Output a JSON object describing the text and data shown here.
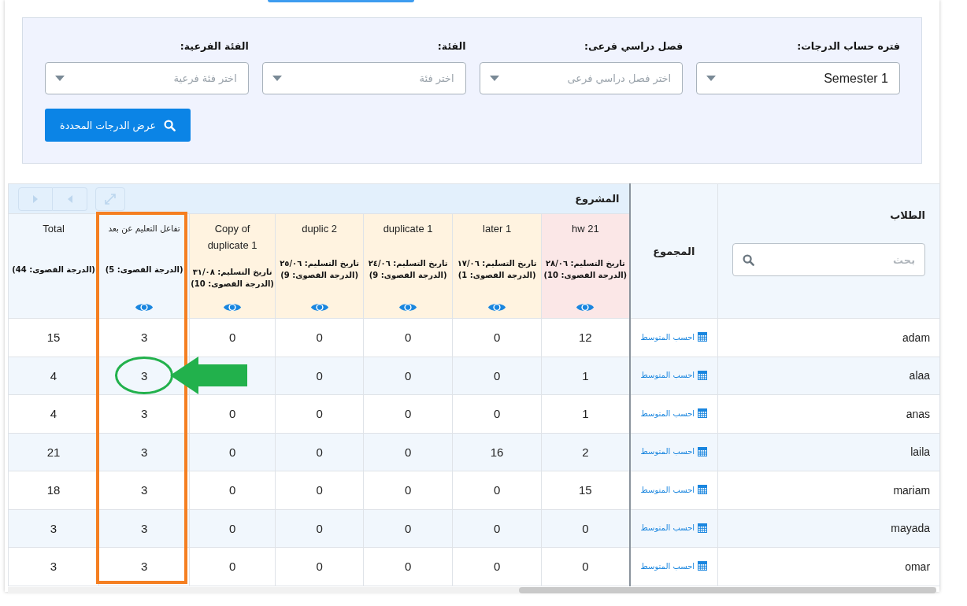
{
  "filters": [
    {
      "label": "فتره حساب الدرجات:",
      "value": "Semester 1"
    },
    {
      "label": "فصل دراسي فرعى:",
      "placeholder": "اختر فصل دراسي فرعى"
    },
    {
      "label": "الفئة:",
      "placeholder": "اختر فئة"
    },
    {
      "label": "الفئة الفرعية:",
      "placeholder": "اختر فئة فرعية"
    }
  ],
  "show_button": {
    "label": "عرض الدرجات المحددة"
  },
  "table": {
    "group_header": "المشروع",
    "columns": [
      {
        "kind": "student",
        "title": "الطلاب",
        "search_placeholder": "بحث"
      },
      {
        "kind": "sum",
        "title": "المجموع"
      },
      {
        "kind": "assignment",
        "title": "hw 21",
        "due": "تاريخ التسليم: ٢٨/٠٦",
        "max": "(الدرجة القصوى: 10)",
        "color": "#fbe7e7",
        "framed": false
      },
      {
        "kind": "assignment",
        "title": "later 1",
        "due": "تاريخ التسليم: ١٧/٠٦",
        "max": "(الدرجة القصوى: 1)",
        "color": "#fff3e0",
        "framed": false
      },
      {
        "kind": "assignment",
        "title": "duplicate 1",
        "due": "تاريخ التسليم: ٢٤/٠٦",
        "max": "(الدرجة القصوى: 9)",
        "color": "#fff3e0",
        "framed": false
      },
      {
        "kind": "assignment",
        "title": "duplic 2",
        "due": "تاريخ التسليم: ٢٥/٠٦",
        "max": "(الدرجة القصوى: 9)",
        "color": "#fff3e0",
        "framed": false
      },
      {
        "kind": "assignment",
        "title": "Copy of duplicate 1",
        "due": "تاريخ التسليم: ٣١/٠٨",
        "max": "(الدرجة القصوى: 10)",
        "color": "#fff3e0",
        "framed": false
      },
      {
        "kind": "category",
        "title": "تفاعل التعليم عن بعد",
        "max": "(الدرجة القصوى: 5)",
        "color": "#f1f7fd",
        "framed": true
      },
      {
        "kind": "total",
        "title": "Total",
        "max": "(الدرجة القصوى: 44)",
        "color": "#f1f7fd",
        "framed": false
      }
    ],
    "rows": [
      {
        "name": "adam",
        "action": "احسب المتوسط",
        "scores": [
          {
            "value": "12"
          },
          {
            "value": "0"
          },
          {
            "value": "0"
          },
          {
            "value": "0"
          },
          {
            "value": "0"
          },
          {
            "value": "3"
          },
          {
            "value": "15"
          }
        ]
      },
      {
        "name": "alaa",
        "action": "احسب المتوسط",
        "scores": [
          {
            "value": "1"
          },
          {
            "value": "0"
          },
          {
            "value": "0"
          },
          {
            "value": "0"
          },
          {
            "covered": true
          },
          {
            "value": "3",
            "circled": true
          },
          {
            "value": "4"
          }
        ]
      },
      {
        "name": "anas",
        "action": "احسب المتوسط",
        "scores": [
          {
            "value": "1"
          },
          {
            "value": "0"
          },
          {
            "value": "0"
          },
          {
            "value": "0"
          },
          {
            "value": "0"
          },
          {
            "value": "3"
          },
          {
            "value": "4"
          }
        ]
      },
      {
        "name": "laila",
        "action": "احسب المتوسط",
        "scores": [
          {
            "value": "2"
          },
          {
            "value": "16"
          },
          {
            "value": "0"
          },
          {
            "value": "0"
          },
          {
            "value": "0"
          },
          {
            "value": "3"
          },
          {
            "value": "21"
          }
        ]
      },
      {
        "name": "mariam",
        "action": "احسب المتوسط",
        "scores": [
          {
            "value": "15"
          },
          {
            "value": "0"
          },
          {
            "value": "0"
          },
          {
            "value": "0"
          },
          {
            "value": "0"
          },
          {
            "value": "3"
          },
          {
            "value": "18"
          }
        ]
      },
      {
        "name": "mayada",
        "action": "احسب المتوسط",
        "scores": [
          {
            "value": "0"
          },
          {
            "value": "0"
          },
          {
            "value": "0"
          },
          {
            "value": "0"
          },
          {
            "value": "0"
          },
          {
            "value": "3"
          },
          {
            "value": "3"
          }
        ]
      },
      {
        "name": "omar",
        "action": "احسب المتوسط",
        "scores": [
          {
            "value": "0"
          },
          {
            "value": "0"
          },
          {
            "value": "0"
          },
          {
            "value": "0"
          },
          {
            "value": "0"
          },
          {
            "value": "3"
          },
          {
            "value": "3"
          }
        ]
      }
    ]
  },
  "annotations": [
    {
      "kind": "column-frame",
      "color": "#f57f21"
    },
    {
      "kind": "circle",
      "color": "#22b14c"
    },
    {
      "kind": "arrow",
      "color": "#22b14c"
    }
  ]
}
